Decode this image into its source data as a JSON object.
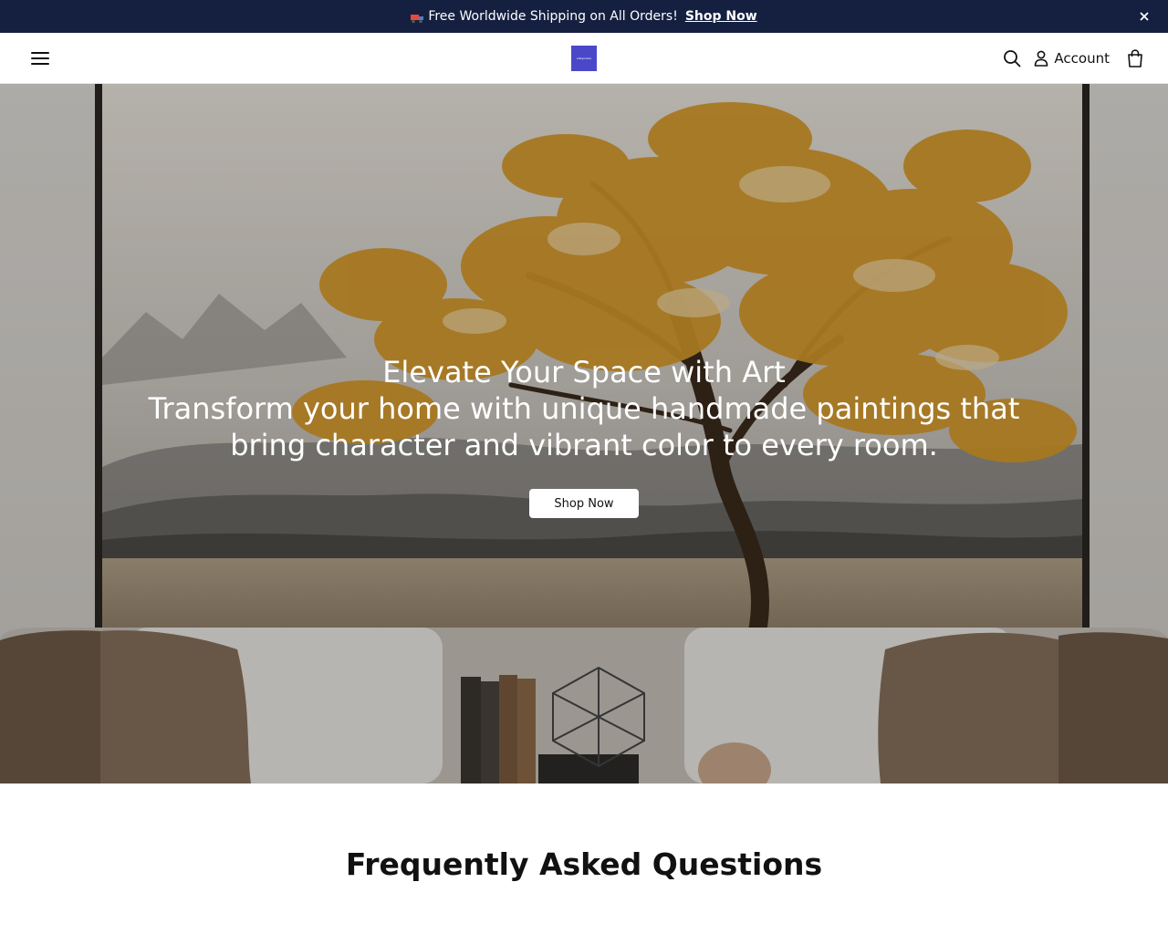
{
  "announcement": {
    "message": "Free Worldwide Shipping on All Orders!",
    "link_label": "Shop Now",
    "icon": "truck-icon"
  },
  "header": {
    "logo_text": "artkymade",
    "account_label": "Account",
    "icons": [
      "menu-icon",
      "search-icon",
      "user-icon",
      "bag-icon"
    ]
  },
  "hero": {
    "title": "Elevate Your Space with Art",
    "subtitle": "Transform your home with unique handmade paintings that bring character and vibrant color to every room.",
    "cta_label": "Shop Now"
  },
  "faq": {
    "heading": "Frequently Asked Questions"
  },
  "colors": {
    "announcement_bg": "#152040",
    "logo_bg": "#4a48c8",
    "hero_leaf": "#d69a2a"
  }
}
